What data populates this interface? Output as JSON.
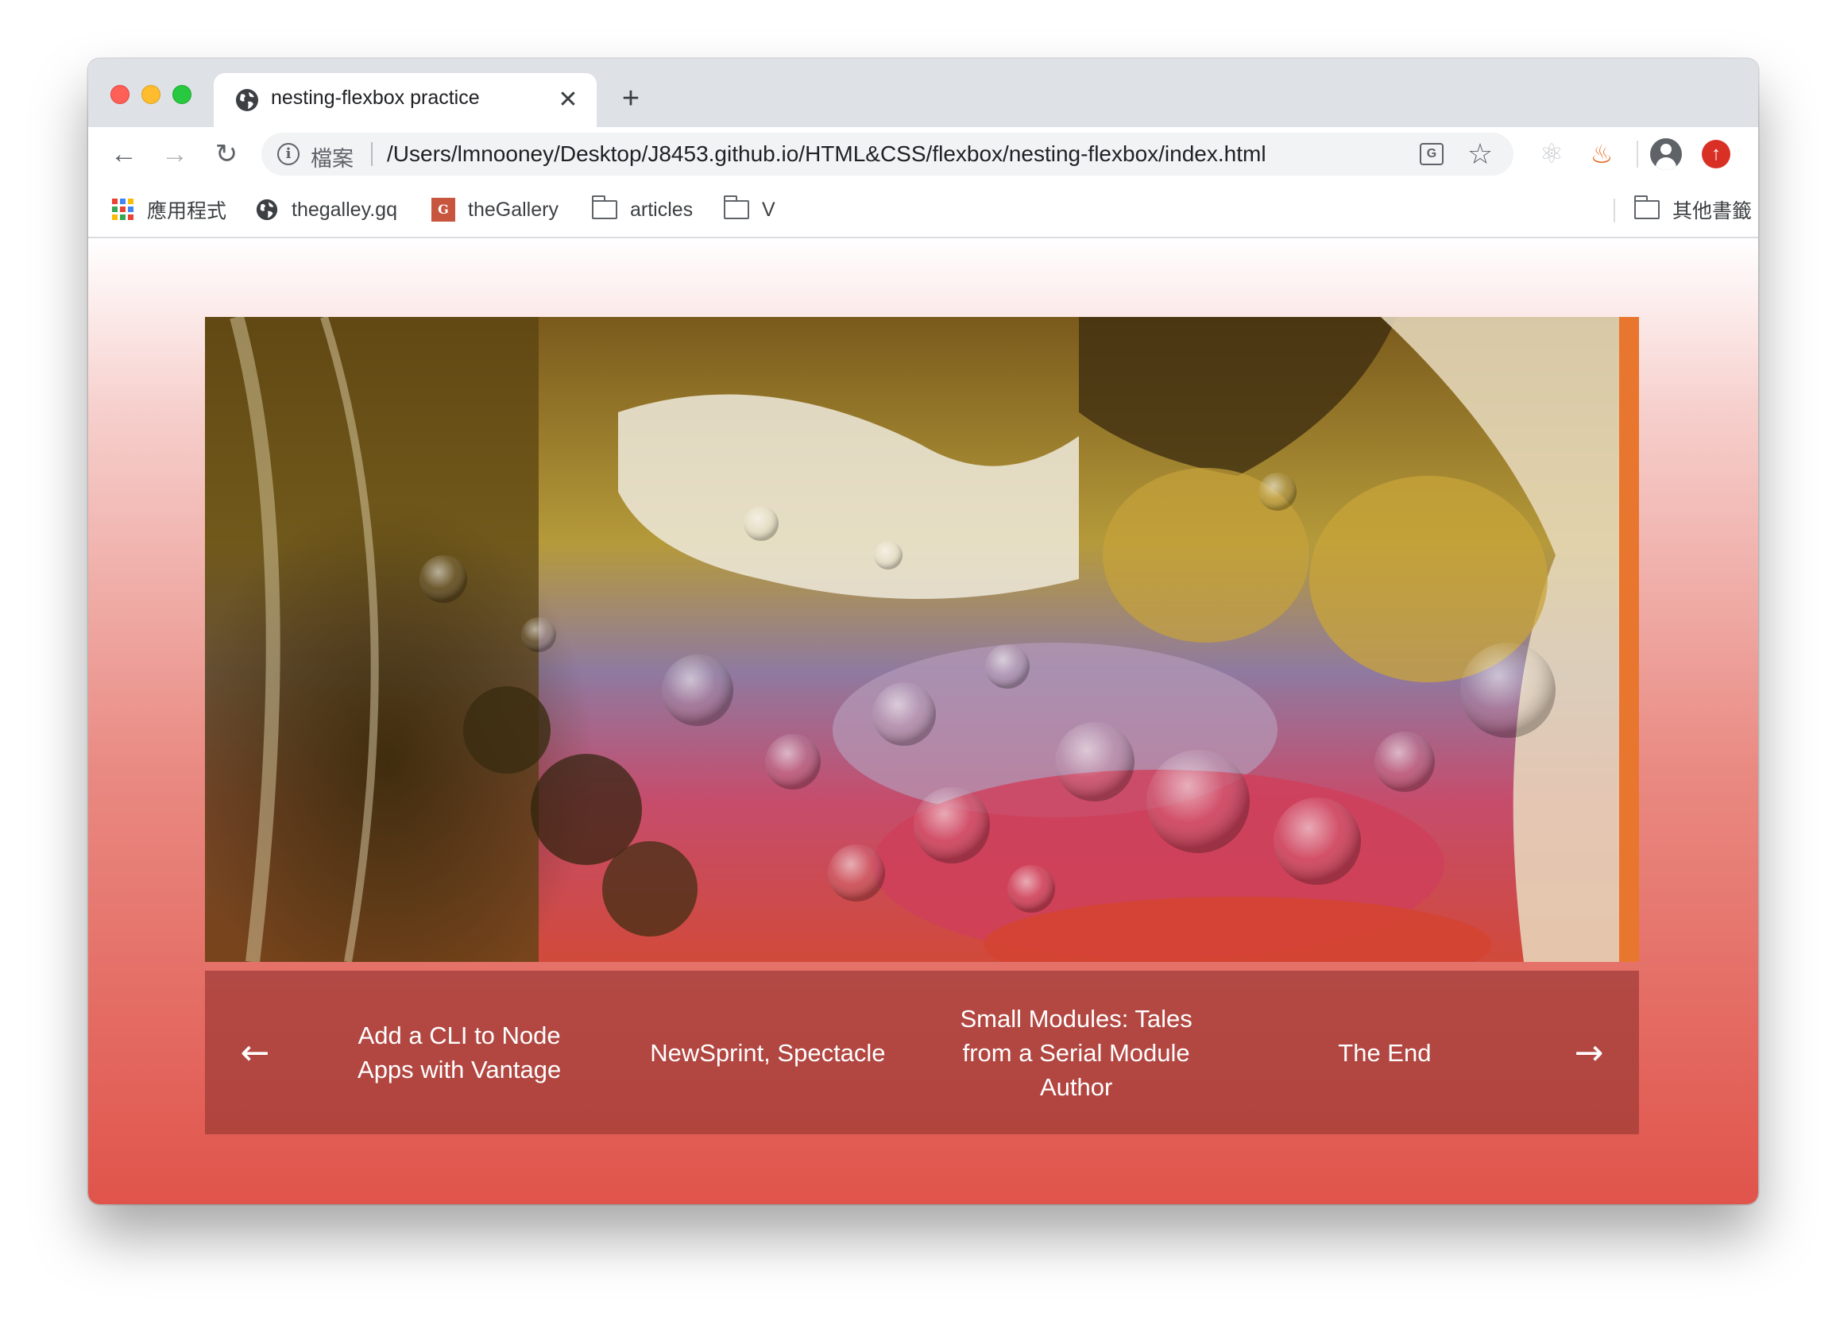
{
  "browser": {
    "tab": {
      "title": "nesting-flexbox practice",
      "close_glyph": "✕"
    },
    "new_tab_glyph": "+",
    "nav": {
      "back_glyph": "←",
      "forward_glyph": "→",
      "reload_glyph": "↻"
    },
    "omnibox": {
      "scheme_label": "檔案",
      "url": "/Users/lmnooney/Desktop/J8453.github.io/HTML&CSS/flexbox/nesting-flexbox/index.html"
    },
    "icons": [
      "info-icon",
      "translate-icon",
      "star-icon",
      "react-extension-icon",
      "fire-extension-icon",
      "avatar-icon",
      "update-icon"
    ]
  },
  "bookmarks": {
    "items": [
      {
        "label": "應用程式",
        "icon": "apps-grid-icon"
      },
      {
        "label": "thegalley.gq",
        "icon": "globe-icon"
      },
      {
        "label": "theGallery",
        "icon": "gallery-g-icon"
      },
      {
        "label": "articles",
        "icon": "folder-icon"
      },
      {
        "label": "V",
        "icon": "folder-icon"
      }
    ],
    "other": {
      "label": "其他書籤",
      "icon": "folder-icon"
    }
  },
  "page": {
    "hero_image": "oil-droplets-abstract",
    "pager": {
      "prev_glyph": "←",
      "next_glyph": "→",
      "items": [
        "Add a CLI to Node Apps with Vantage",
        "NewSprint, Spectacle",
        "Small Modules: Tales from a Serial Module Author",
        "The End"
      ]
    }
  },
  "colors": {
    "tab_strip": "#dee1e6",
    "pager_bg": "#a03a36",
    "page_gradient_bottom": "#e0544b"
  }
}
